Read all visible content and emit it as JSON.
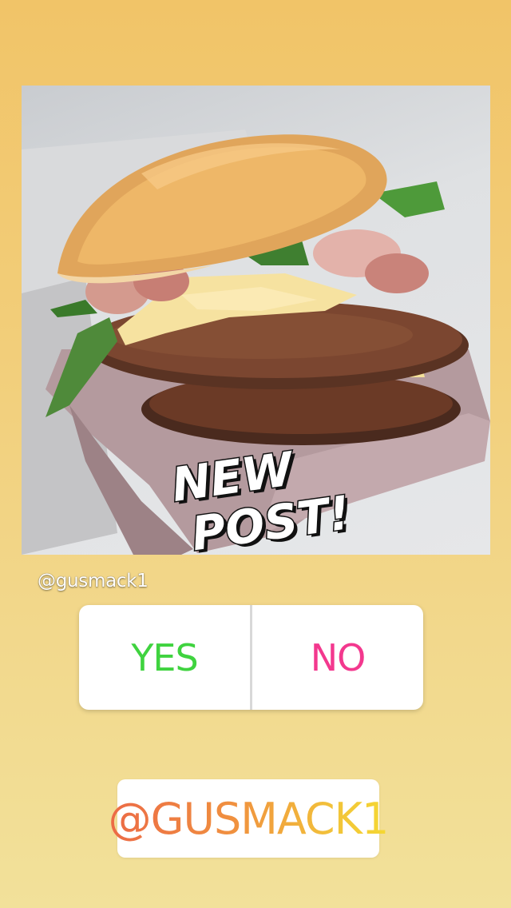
{
  "story": {
    "sticker_text": [
      "NEW",
      "POST!"
    ],
    "username_tag": "@gusmack1",
    "poll": {
      "option_yes": "YES",
      "option_no": "NO"
    },
    "mention": "@GUSMACK1"
  },
  "colors": {
    "background_top": "#f1c468",
    "background_bottom": "#f2e19a",
    "poll_yes": "#3fd33f",
    "poll_no": "#f3388e",
    "mention_gradient": [
      "#ec6a46",
      "#f2c23a",
      "#f5d832"
    ]
  }
}
